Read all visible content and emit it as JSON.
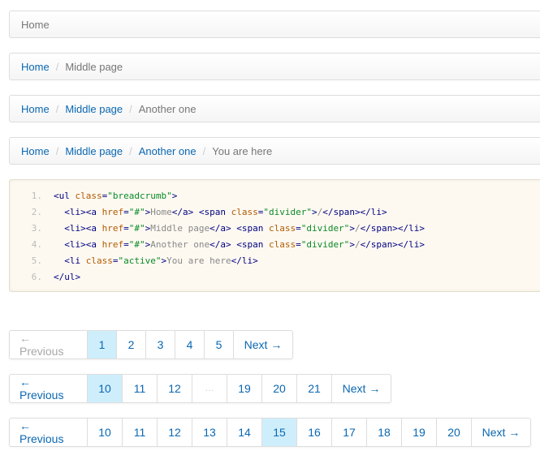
{
  "breadcrumbs": [
    {
      "items": [],
      "active": "Home"
    },
    {
      "items": [
        "Home"
      ],
      "active": "Middle page"
    },
    {
      "items": [
        "Home",
        "Middle page"
      ],
      "active": "Another one"
    },
    {
      "items": [
        "Home",
        "Middle page",
        "Another one"
      ],
      "active": "You are here"
    }
  ],
  "divider": "/",
  "code": {
    "line_numbers": [
      "1.",
      "2.",
      "3.",
      "4.",
      "5.",
      "6."
    ],
    "lines": [
      [
        {
          "c": "t",
          "v": "<ul "
        },
        {
          "c": "at",
          "v": "class"
        },
        {
          "c": "t",
          "v": "="
        },
        {
          "c": "s",
          "v": "\"breadcrumb\""
        },
        {
          "c": "t",
          "v": ">"
        }
      ],
      [
        {
          "c": "t",
          "v": "  <li><a "
        },
        {
          "c": "at",
          "v": "href"
        },
        {
          "c": "t",
          "v": "="
        },
        {
          "c": "s",
          "v": "\"#\""
        },
        {
          "c": "t",
          "v": ">"
        },
        {
          "c": "tx",
          "v": "Home"
        },
        {
          "c": "t",
          "v": "</a> <span "
        },
        {
          "c": "at",
          "v": "class"
        },
        {
          "c": "t",
          "v": "="
        },
        {
          "c": "s",
          "v": "\"divider\""
        },
        {
          "c": "t",
          "v": ">"
        },
        {
          "c": "tx",
          "v": "/"
        },
        {
          "c": "t",
          "v": "</span></li>"
        }
      ],
      [
        {
          "c": "t",
          "v": "  <li><a "
        },
        {
          "c": "at",
          "v": "href"
        },
        {
          "c": "t",
          "v": "="
        },
        {
          "c": "s",
          "v": "\"#\""
        },
        {
          "c": "t",
          "v": ">"
        },
        {
          "c": "tx",
          "v": "Middle page"
        },
        {
          "c": "t",
          "v": "</a> <span "
        },
        {
          "c": "at",
          "v": "class"
        },
        {
          "c": "t",
          "v": "="
        },
        {
          "c": "s",
          "v": "\"divider\""
        },
        {
          "c": "t",
          "v": ">"
        },
        {
          "c": "tx",
          "v": "/"
        },
        {
          "c": "t",
          "v": "</span></li>"
        }
      ],
      [
        {
          "c": "t",
          "v": "  <li><a "
        },
        {
          "c": "at",
          "v": "href"
        },
        {
          "c": "t",
          "v": "="
        },
        {
          "c": "s",
          "v": "\"#\""
        },
        {
          "c": "t",
          "v": ">"
        },
        {
          "c": "tx",
          "v": "Another one"
        },
        {
          "c": "t",
          "v": "</a> <span "
        },
        {
          "c": "at",
          "v": "class"
        },
        {
          "c": "t",
          "v": "="
        },
        {
          "c": "s",
          "v": "\"divider\""
        },
        {
          "c": "t",
          "v": ">"
        },
        {
          "c": "tx",
          "v": "/"
        },
        {
          "c": "t",
          "v": "</span></li>"
        }
      ],
      [
        {
          "c": "t",
          "v": "  <li "
        },
        {
          "c": "at",
          "v": "class"
        },
        {
          "c": "t",
          "v": "="
        },
        {
          "c": "s",
          "v": "\"active\""
        },
        {
          "c": "t",
          "v": ">"
        },
        {
          "c": "tx",
          "v": "You are here"
        },
        {
          "c": "t",
          "v": "</li>"
        }
      ],
      [
        {
          "c": "t",
          "v": "</ul>"
        }
      ]
    ]
  },
  "pagination": [
    {
      "items": [
        {
          "label": "← Previous",
          "state": "disabled"
        },
        {
          "label": "1",
          "state": "active"
        },
        {
          "label": "2",
          "state": ""
        },
        {
          "label": "3",
          "state": ""
        },
        {
          "label": "4",
          "state": ""
        },
        {
          "label": "5",
          "state": ""
        },
        {
          "label": "Next →",
          "state": ""
        }
      ]
    },
    {
      "items": [
        {
          "label": "← Previous",
          "state": ""
        },
        {
          "label": "10",
          "state": "active"
        },
        {
          "label": "11",
          "state": ""
        },
        {
          "label": "12",
          "state": ""
        },
        {
          "label": "…",
          "state": "ellipsis"
        },
        {
          "label": "19",
          "state": ""
        },
        {
          "label": "20",
          "state": ""
        },
        {
          "label": "21",
          "state": ""
        },
        {
          "label": "Next →",
          "state": ""
        }
      ]
    },
    {
      "items": [
        {
          "label": "← Previous",
          "state": ""
        },
        {
          "label": "10",
          "state": ""
        },
        {
          "label": "11",
          "state": ""
        },
        {
          "label": "12",
          "state": ""
        },
        {
          "label": "13",
          "state": ""
        },
        {
          "label": "14",
          "state": ""
        },
        {
          "label": "15",
          "state": "active"
        },
        {
          "label": "16",
          "state": ""
        },
        {
          "label": "17",
          "state": ""
        },
        {
          "label": "18",
          "state": ""
        },
        {
          "label": "19",
          "state": ""
        },
        {
          "label": "20",
          "state": ""
        },
        {
          "label": "Next →",
          "state": ""
        }
      ]
    }
  ]
}
